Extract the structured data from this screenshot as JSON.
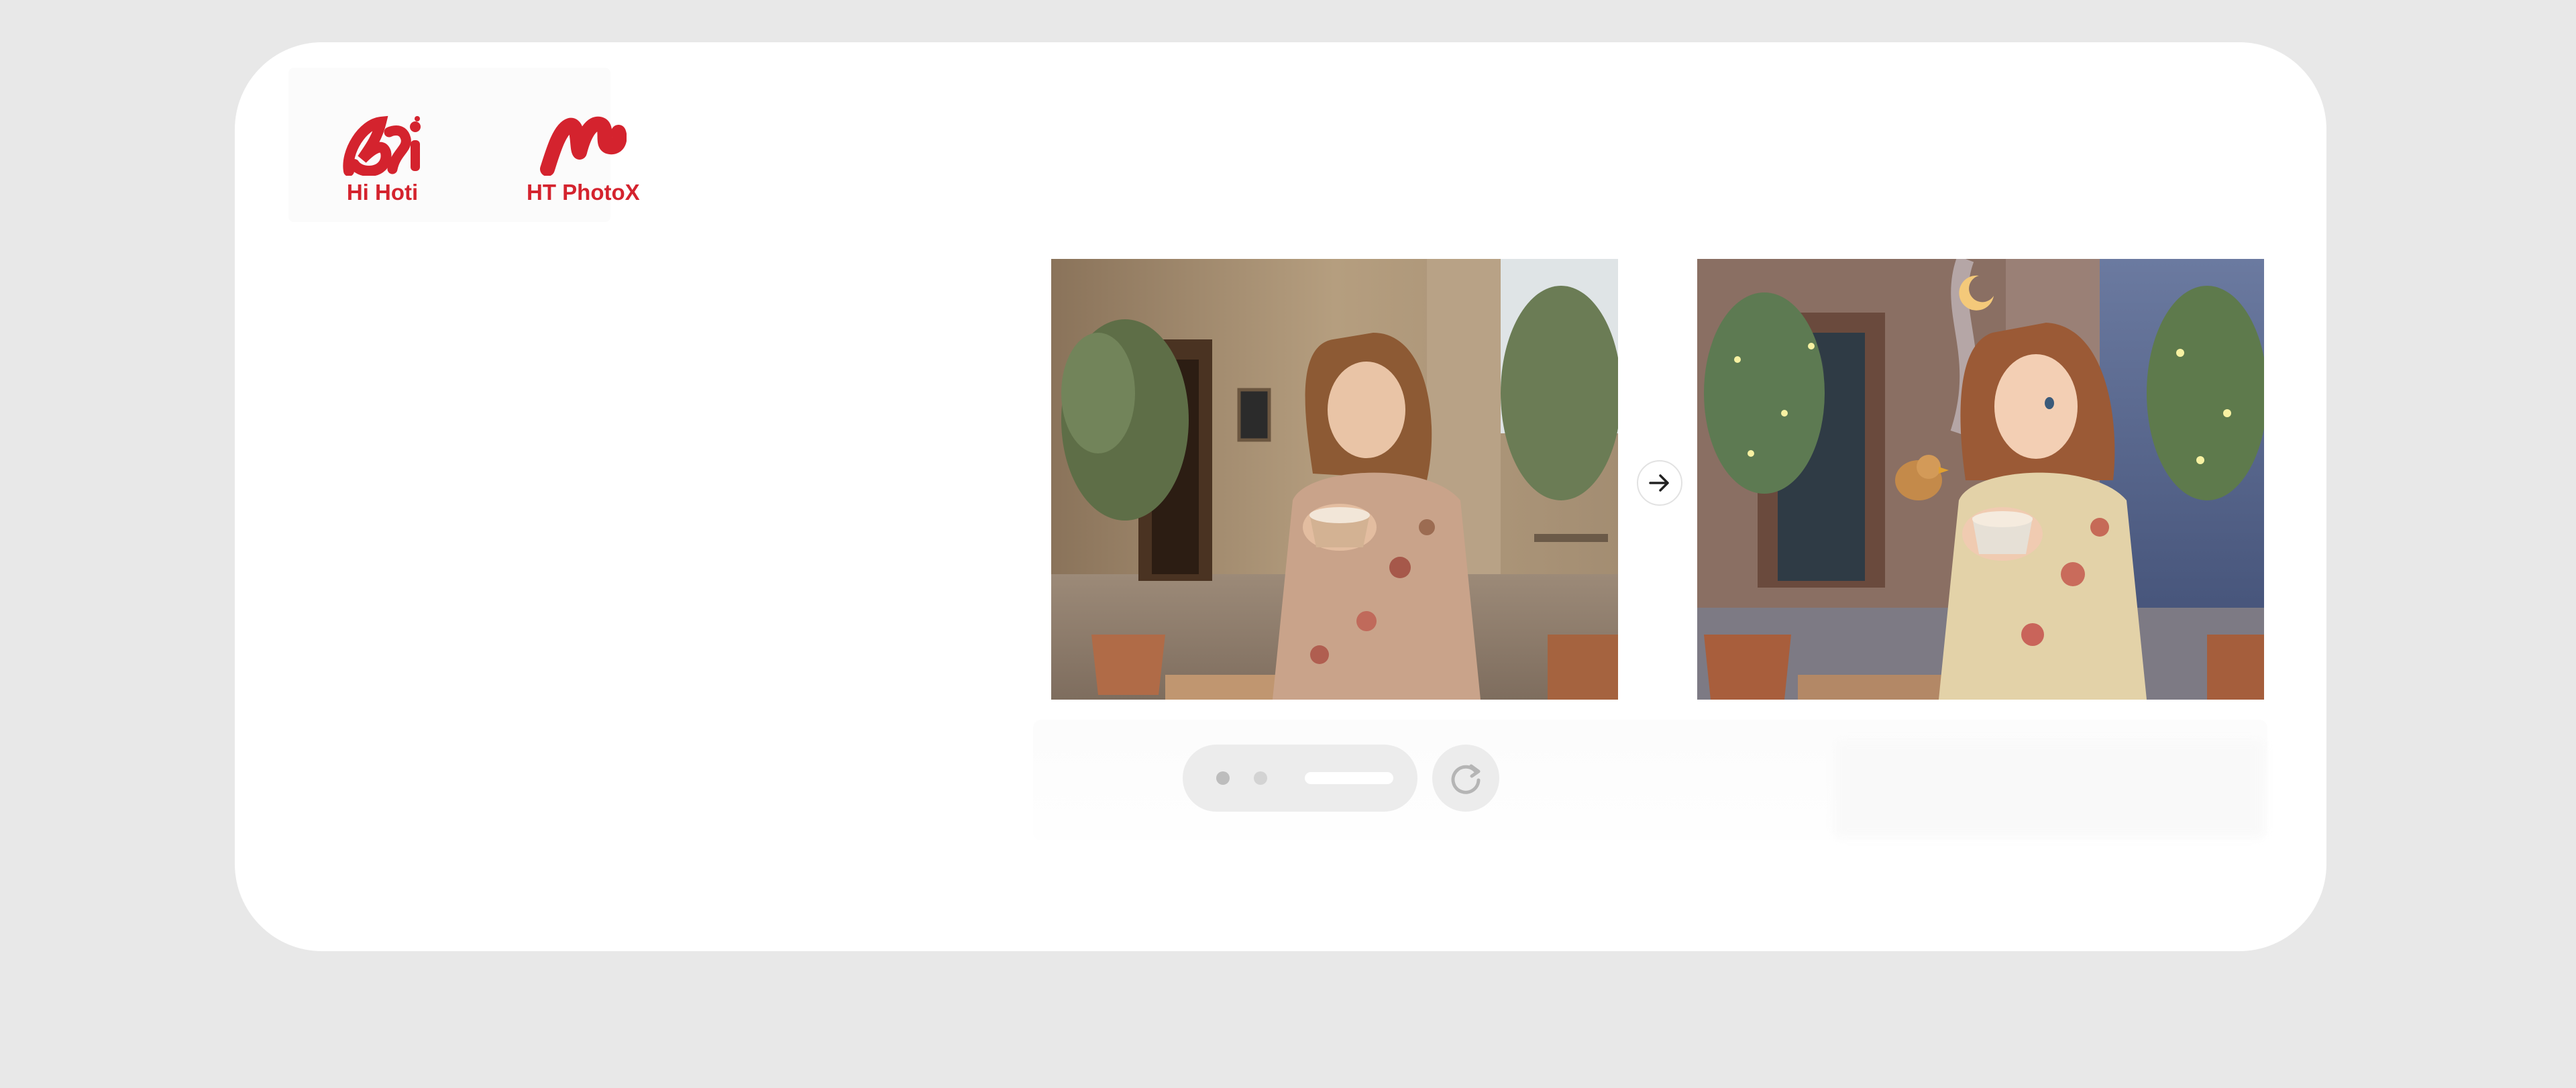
{
  "brands": {
    "first": {
      "label": "Hi Hoti",
      "icon": "hi-hoti-logo-icon"
    },
    "second": {
      "label": "HT PhotoX",
      "icon": "ht-photox-logo-icon"
    }
  },
  "images": {
    "before": {
      "description_icon": "photo-woman-cafe-icon"
    },
    "after": {
      "description_icon": "cartoon-woman-cafe-icon"
    }
  },
  "controls": {
    "compare_arrow_icon": "arrow-right-icon",
    "refresh_icon": "refresh-icon",
    "pager": {
      "dots": 2,
      "active_index": 0
    }
  },
  "colors": {
    "brand_red": "#d4232e",
    "page_bg": "#e8e8e8",
    "card_bg": "#ffffff",
    "control_bg": "#ececec"
  }
}
